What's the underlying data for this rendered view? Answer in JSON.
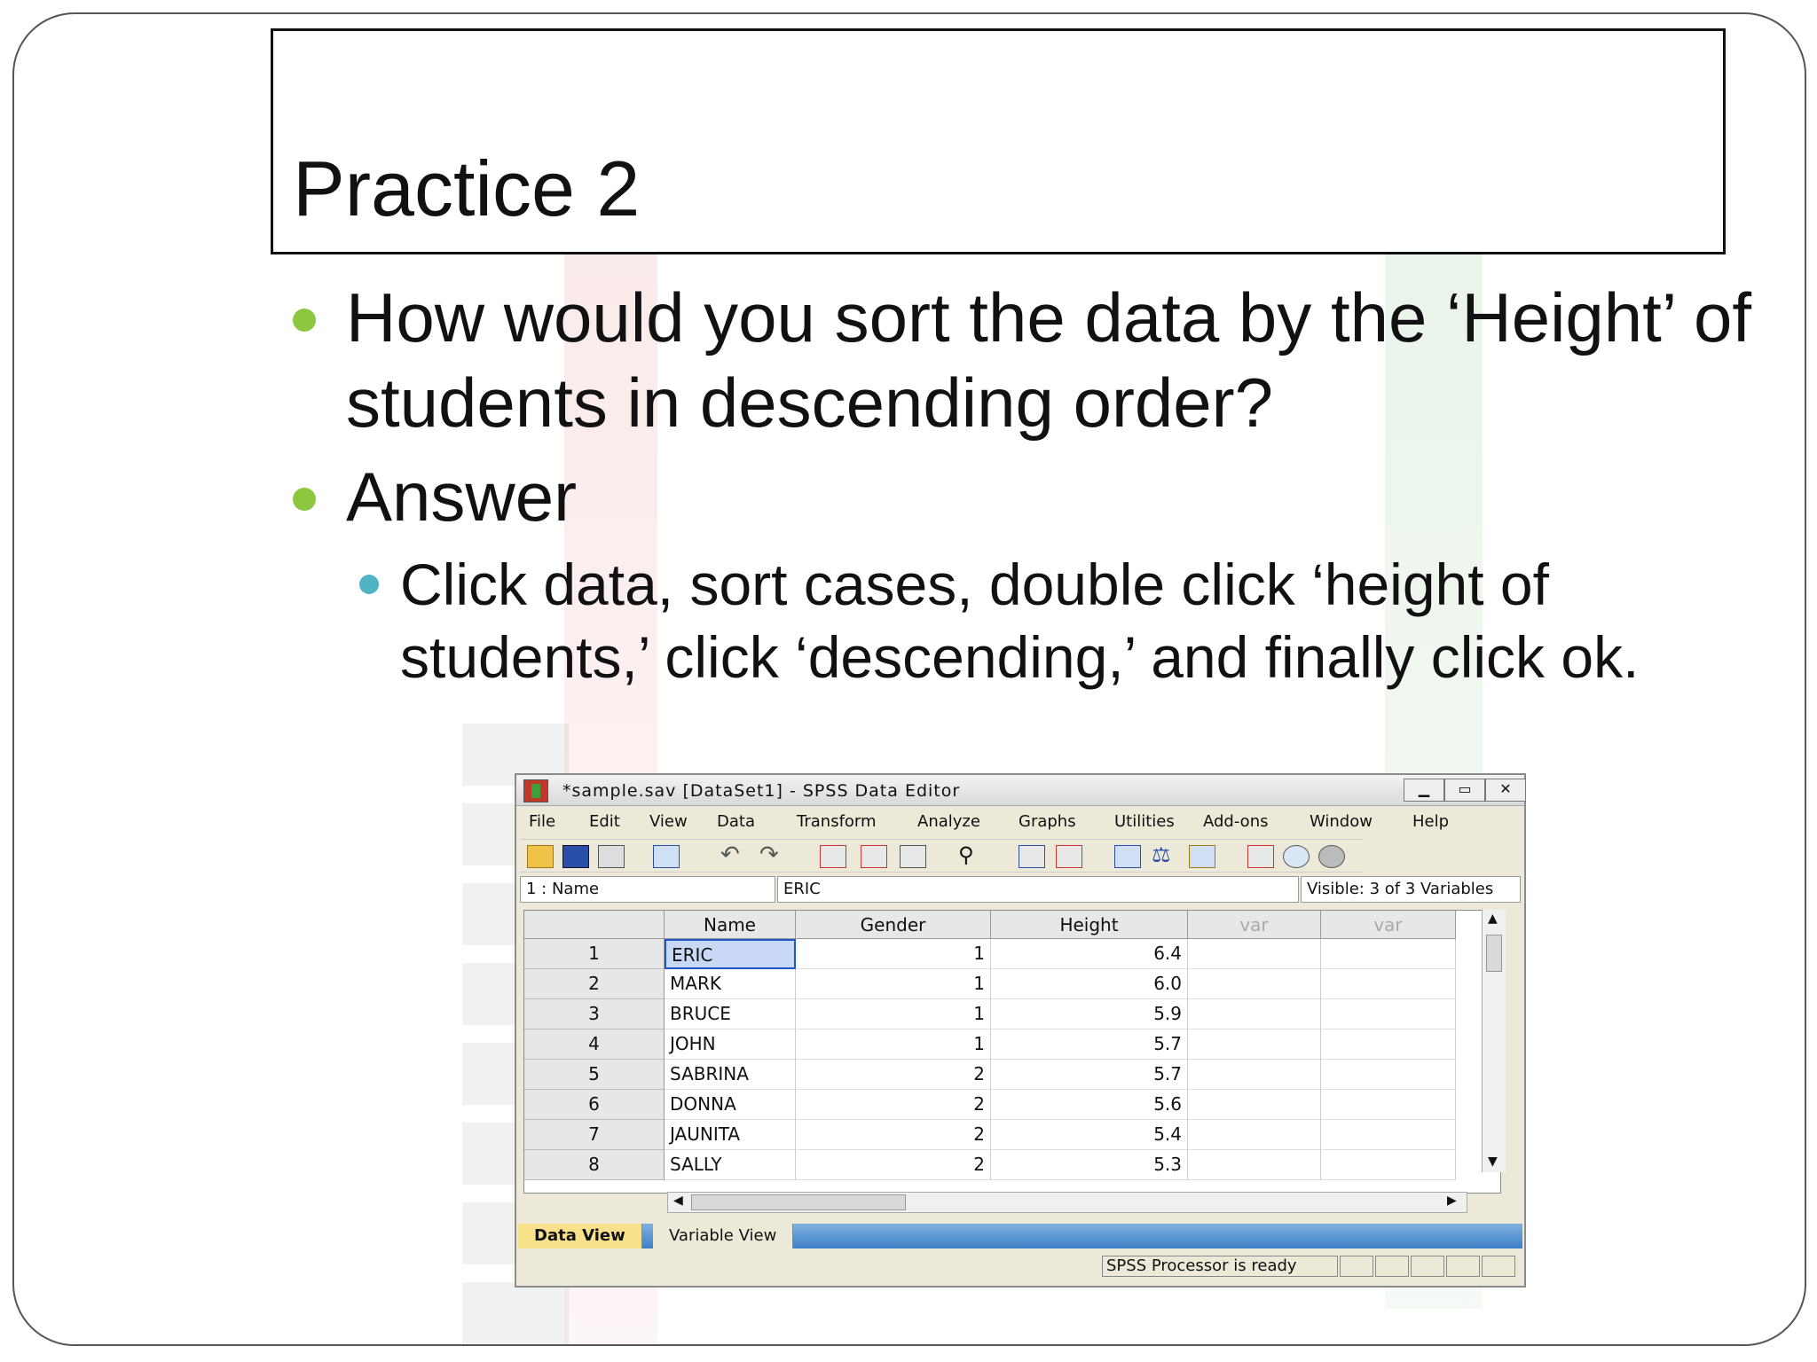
{
  "slide": {
    "title": "Practice 2",
    "bullets": [
      "How would you sort the data by the ‘Height’ of students in descending order?",
      "Answer"
    ],
    "sub_bullet": "Click data, sort cases, double click ‘height of students,’ click ‘descending,’ and finally click ok."
  },
  "spss": {
    "window_title": "*sample.sav [DataSet1] - SPSS Data Editor",
    "menu": [
      "File",
      "Edit",
      "View",
      "Data",
      "Transform",
      "Analyze",
      "Graphs",
      "Utilities",
      "Add-ons",
      "Window",
      "Help"
    ],
    "cell_ref": "1 : Name",
    "cell_value": "ERIC",
    "visible": "Visible: 3 of 3 Variables",
    "columns": [
      "Name",
      "Gender",
      "Height",
      "var",
      "var"
    ],
    "rows": [
      {
        "n": "1",
        "name": "ERIC",
        "gender": "1",
        "height": "6.4"
      },
      {
        "n": "2",
        "name": "MARK",
        "gender": "1",
        "height": "6.0"
      },
      {
        "n": "3",
        "name": "BRUCE",
        "gender": "1",
        "height": "5.9"
      },
      {
        "n": "4",
        "name": "JOHN",
        "gender": "1",
        "height": "5.7"
      },
      {
        "n": "5",
        "name": "SABRINA",
        "gender": "2",
        "height": "5.7"
      },
      {
        "n": "6",
        "name": "DONNA",
        "gender": "2",
        "height": "5.6"
      },
      {
        "n": "7",
        "name": "JAUNITA",
        "gender": "2",
        "height": "5.4"
      },
      {
        "n": "8",
        "name": "SALLY",
        "gender": "2",
        "height": "5.3"
      }
    ],
    "tabs": {
      "data_view": "Data View",
      "variable_view": "Variable View"
    },
    "status": "SPSS  Processor is ready",
    "colors": {
      "tab_active": "#f7e18a",
      "selected_cell": "#c9d8f5",
      "bullet1": "#8dc63f",
      "bullet2": "#4fb3c4"
    }
  }
}
